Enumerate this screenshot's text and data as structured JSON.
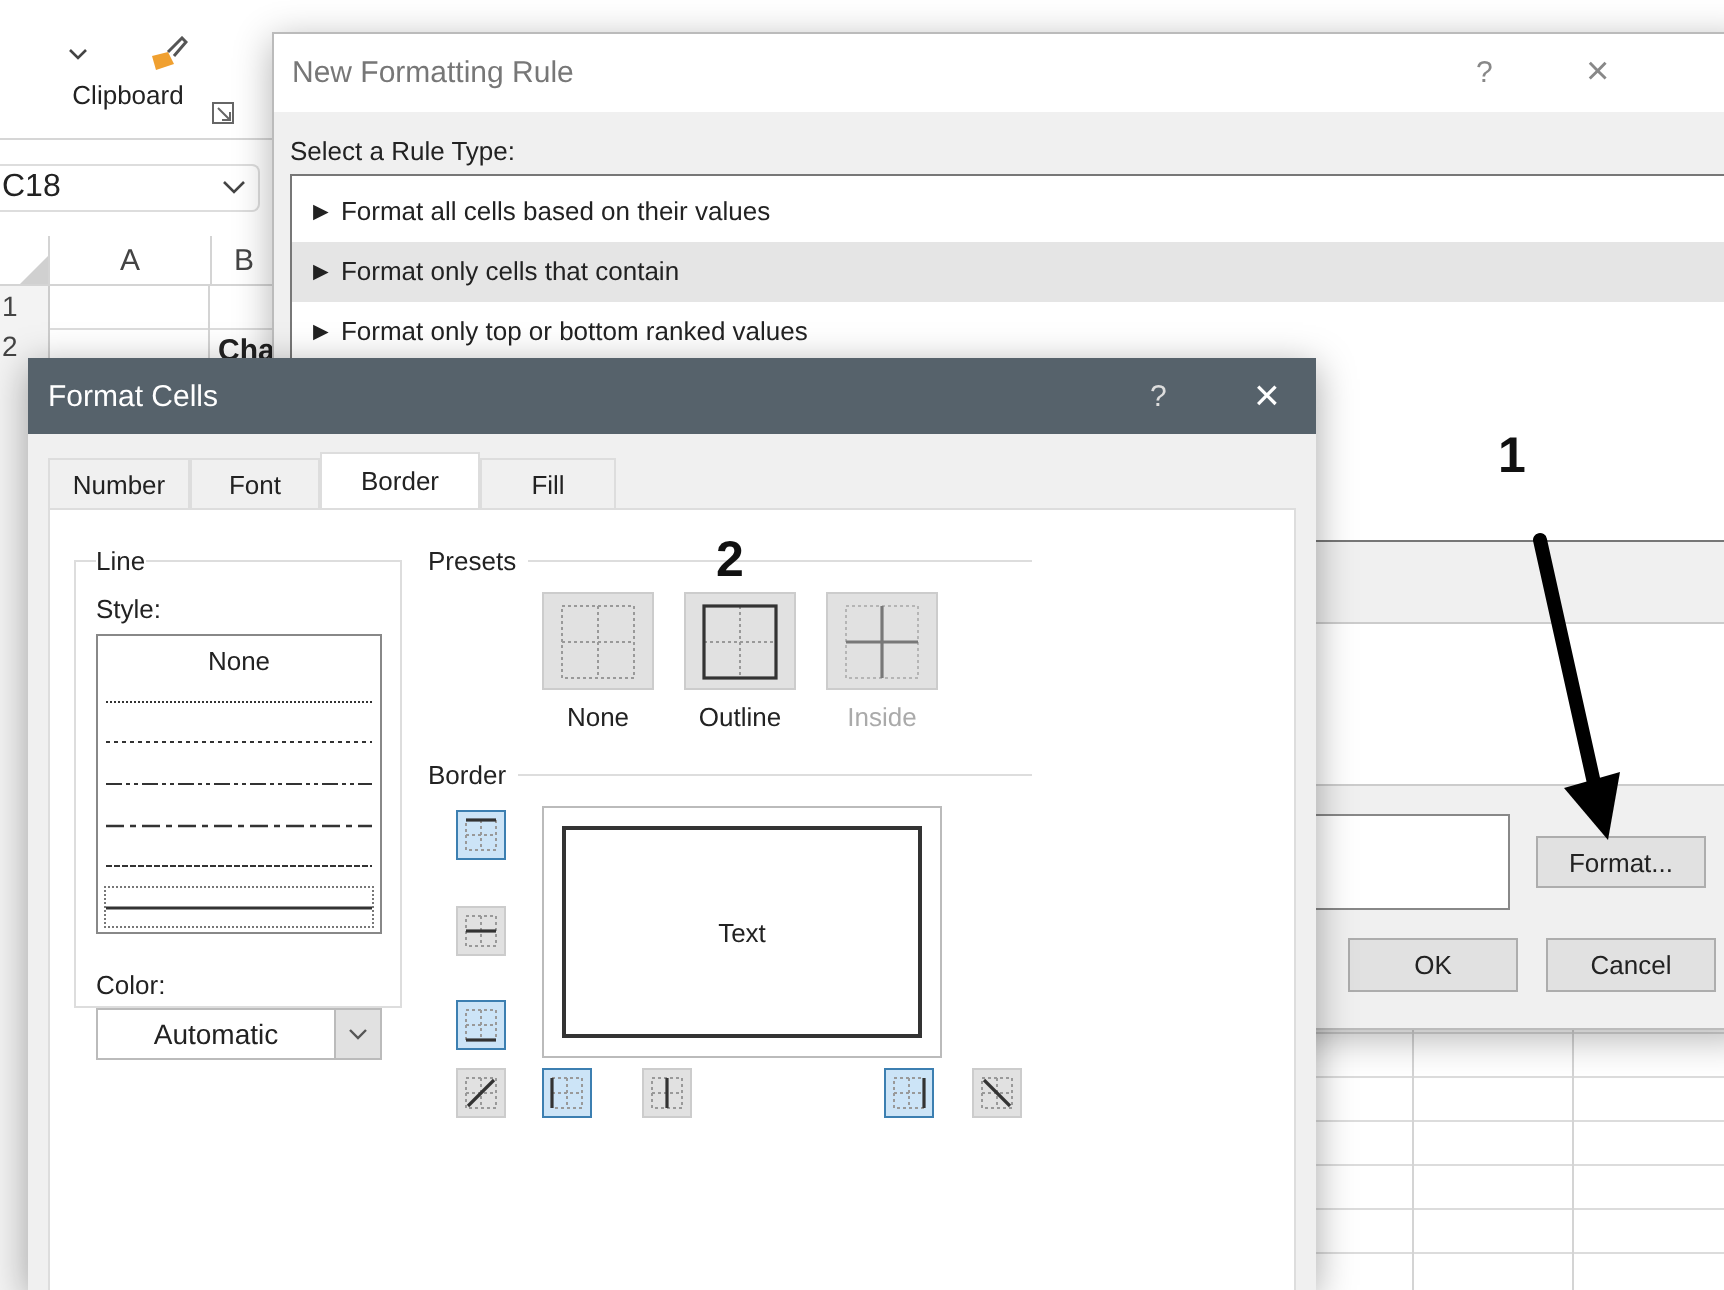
{
  "excel": {
    "clipboard_label": "Clipboard",
    "name_box": "C18",
    "columns": [
      "A",
      "B"
    ],
    "rows": [
      "1",
      "2"
    ],
    "cell_text": "Cha"
  },
  "rule_dialog": {
    "title": "New Formatting Rule",
    "help": "?",
    "close": "×",
    "section_label": "Select a Rule Type:",
    "rule_types": [
      {
        "label": "► Format all cells based on their values",
        "selected": false
      },
      {
        "label": "► Format only cells that contain",
        "selected": true
      },
      {
        "label": "► Format only top or bottom ranked values",
        "selected": false
      }
    ],
    "format_button": "Format...",
    "buttons": [
      "OK",
      "Cancel"
    ]
  },
  "format_dialog": {
    "title": "Format Cells",
    "help": "?",
    "close": "×",
    "tabs": [
      {
        "label": "Number",
        "selected": false
      },
      {
        "label": "Font",
        "selected": false
      },
      {
        "label": "Border",
        "selected": true
      },
      {
        "label": "Fill",
        "selected": false
      }
    ],
    "line_group": "Line",
    "style_label": "Style:",
    "styles": [
      {
        "kind": "none",
        "label": "None",
        "selected": false
      },
      {
        "kind": "hair",
        "selected": false
      },
      {
        "kind": "dotted",
        "selected": false
      },
      {
        "kind": "dashdotdot",
        "selected": false
      },
      {
        "kind": "dashdot",
        "selected": false
      },
      {
        "kind": "dashed",
        "selected": false
      },
      {
        "kind": "solid",
        "selected": true
      }
    ],
    "color_label": "Color:",
    "color_value": "Automatic",
    "presets_label": "Presets",
    "presets": [
      {
        "kind": "none",
        "label": "None",
        "disabled": false
      },
      {
        "kind": "outline",
        "label": "Outline",
        "disabled": false
      },
      {
        "kind": "inside",
        "label": "Inside",
        "disabled": true
      }
    ],
    "border_label": "Border",
    "border_buttons": [
      {
        "kind": "top",
        "on": true
      },
      {
        "kind": "middle_h",
        "on": false
      },
      {
        "kind": "bottom",
        "on": true
      },
      {
        "kind": "diag_up",
        "on": false
      },
      {
        "kind": "left",
        "on": true
      },
      {
        "kind": "middle_v",
        "on": false
      },
      {
        "kind": "right",
        "on": true
      },
      {
        "kind": "diag_down",
        "on": false
      }
    ],
    "preview_text": "Text"
  },
  "annotations": [
    {
      "label": "1",
      "kind": "arrow"
    },
    {
      "label": "2",
      "kind": "plain"
    }
  ]
}
